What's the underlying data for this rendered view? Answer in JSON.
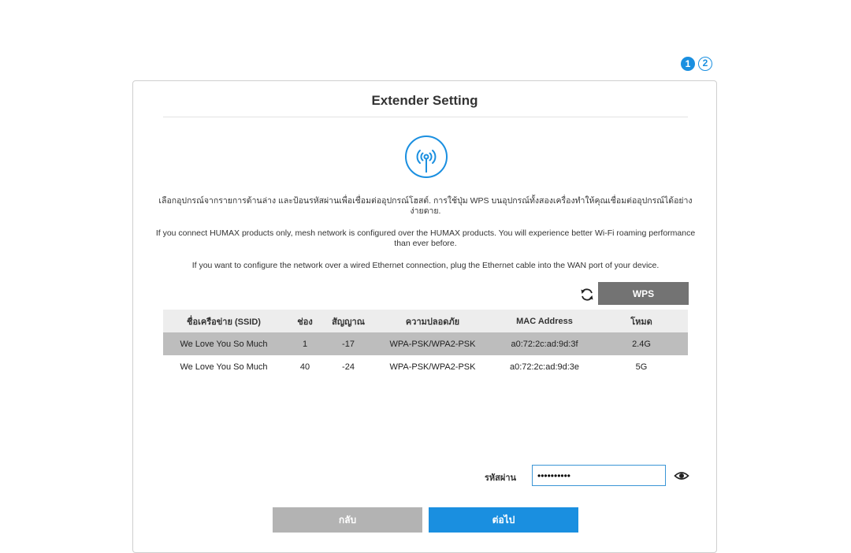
{
  "steps": [
    "1",
    "2"
  ],
  "title": "Extender Setting",
  "description": {
    "thai": "เลือกอุปกรณ์จากรายการด้านล่าง และป้อนรหัสผ่านเพื่อเชื่อมต่ออุปกรณ์โฮสต์. การใช้ปุ่ม WPS บนอุปกรณ์ทั้งสองเครื่องทำให้คุณเชื่อมต่ออุปกรณ์ได้อย่างง่ายดาย.",
    "mesh": "If you connect HUMAX products only, mesh network is configured over the HUMAX products. You will experience better Wi-Fi roaming performance than ever before.",
    "wired": "If you want to configure the network over a wired Ethernet connection, plug the Ethernet cable into the WAN port of your device."
  },
  "wps_label": "WPS",
  "table": {
    "headers": [
      "ชื่อเครือข่าย (SSID)",
      "ช่อง",
      "สัญญาณ",
      "ความปลอดภัย",
      "MAC Address",
      "โหมด"
    ],
    "rows": [
      [
        "We Love You So Much",
        "1",
        "-17",
        "WPA-PSK/WPA2-PSK",
        "a0:72:2c:ad:9d:3f",
        "2.4G"
      ],
      [
        "We Love You So Much",
        "40",
        "-24",
        "WPA-PSK/WPA2-PSK",
        "a0:72:2c:ad:9d:3e",
        "5G"
      ]
    ]
  },
  "password": {
    "label": "รหัสผ่าน",
    "value": "••••••••••"
  },
  "buttons": {
    "back": "กลับ",
    "next": "ต่อไป"
  },
  "icons": {
    "ap": "access-point-icon",
    "refresh": "refresh-icon",
    "eye": "eye-icon"
  },
  "colors": {
    "accent": "#1a8fe0",
    "wps": "#737373",
    "back": "#b3b3b3",
    "selected_row": "#bdbdbd"
  }
}
